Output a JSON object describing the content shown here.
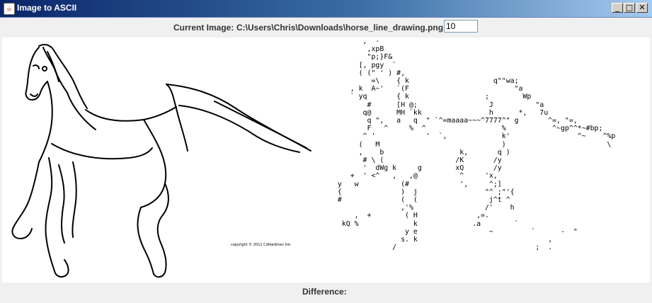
{
  "window": {
    "title": "Image to ASCII",
    "minimize_glyph": "_",
    "maximize_glyph": "□",
    "close_glyph": "✕"
  },
  "toolbar": {
    "current_image_label": "Current Image:",
    "current_image_path": "C:\\Users\\Chris\\Downloads\\horse_line_drawing.png",
    "scale_value": "10"
  },
  "image_panel": {
    "watermark": "copyright © 2011 Cdfeedman Ink."
  },
  "ascii_panel": {
    "lines": [
      "        ,  -",
      "         ,xpB",
      "         \"p;}F&",
      "       [, pgy  `",
      "       ( (\" ' ) #,",
      "          =\\    { k                    q\"\"wa;",
      "     , k  A~'   `(F                         \"a",
      "     ` yq       { k                  ;        Wp",
      "         #      [H @;                 J          \"a",
      "        q@      MH `kk                h      *,   7u",
      "         q \",   a   q  \" `^=maaaa~~~^7777^\" g       ^=, \"=,",
      "         F   ^     %  ^                  %           ^~gp^^*~#bp;",
      "        ^ '            '  `,             k'                ^~    ^%p",
      "       (   M                             )                        \\",
      "       ,    b                  k,       q )",
      "        # \\ (                 /K       /y",
      "        '  dWg k     g        xQ       /y",
      "     +  ' <^   ,   ,@          ^     'x,",
      "  y   w          (#            ',     ^;]",
      "  {              )  j                \"^ ;\"'{",
      "  #              (  (                 j^t ^",
      "                 ,'%                 /'    h",
      "      ,  +        ( H              ,=.",
      "   kQ %             k             .a        `",
      "                  y e                 ~         `      -  \"",
      "                 s. k                               ,",
      "               /                                 ;  ."
    ]
  },
  "status": {
    "difference_label": "Difference:"
  }
}
